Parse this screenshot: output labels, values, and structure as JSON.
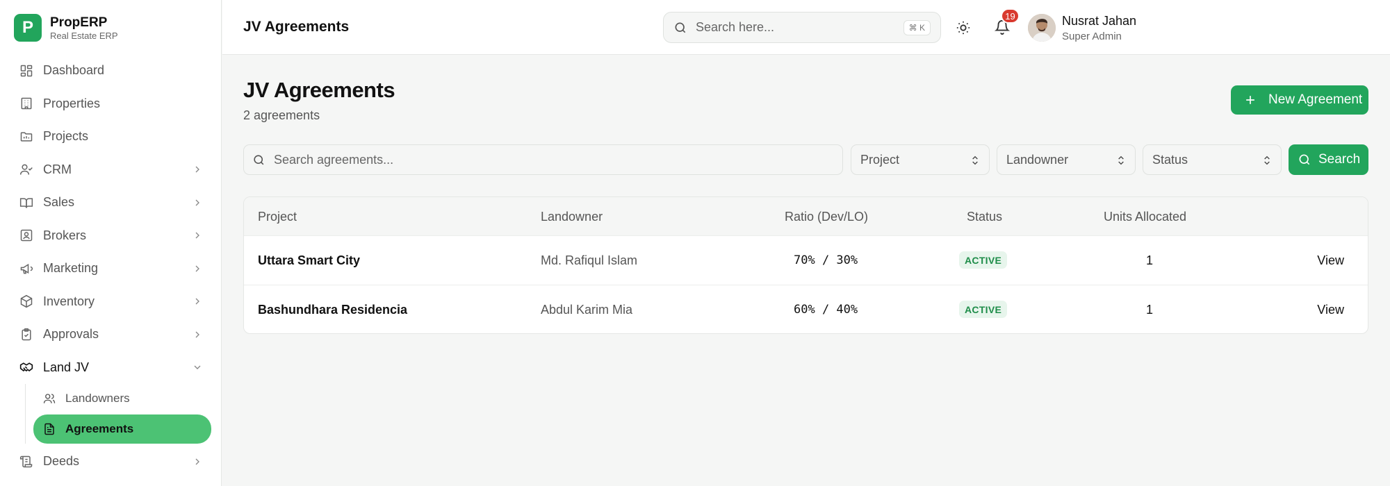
{
  "brand": {
    "name": "PropERP",
    "subtitle": "Real Estate ERP",
    "logo_letter": "P",
    "accent": "#22a55c"
  },
  "sidebar": {
    "items": [
      {
        "label": "Dashboard",
        "icon": "dashboard-icon"
      },
      {
        "label": "Properties",
        "icon": "building-icon"
      },
      {
        "label": "Projects",
        "icon": "folder-icon"
      },
      {
        "label": "CRM",
        "icon": "user-check-icon",
        "expandable": true
      },
      {
        "label": "Sales",
        "icon": "book-icon",
        "expandable": true
      },
      {
        "label": "Brokers",
        "icon": "id-badge-icon",
        "expandable": true
      },
      {
        "label": "Marketing",
        "icon": "megaphone-icon",
        "expandable": true
      },
      {
        "label": "Inventory",
        "icon": "box-icon",
        "expandable": true
      },
      {
        "label": "Approvals",
        "icon": "clipboard-check-icon",
        "expandable": true
      },
      {
        "label": "Land JV",
        "icon": "handshake-icon",
        "expandable": true,
        "open": true
      },
      {
        "label": "Deeds",
        "icon": "scroll-icon",
        "expandable": true
      }
    ],
    "land_jv_sub": [
      {
        "label": "Landowners",
        "icon": "users-icon"
      },
      {
        "label": "Agreements",
        "icon": "file-text-icon",
        "active": true
      }
    ],
    "active_color": "#4cc274"
  },
  "header": {
    "title": "JV Agreements",
    "search_placeholder": "Search here...",
    "shortcut": "⌘ K",
    "notification_count": "19",
    "user_name": "Nusrat Jahan",
    "user_role": "Super Admin"
  },
  "main": {
    "title": "JV Agreements",
    "count": "2 agreements",
    "new_button": "New Agreement",
    "filters": {
      "search_placeholder": "Search agreements...",
      "project": "Project",
      "landowner": "Landowner",
      "status": "Status",
      "search_button": "Search"
    },
    "table": {
      "columns": [
        "Project",
        "Landowner",
        "Ratio (Dev/LO)",
        "Status",
        "Units Allocated"
      ],
      "rows": [
        {
          "project": "Uttara Smart City",
          "landowner": "Md. Rafiqul Islam",
          "ratio": "70% / 30%",
          "status": "ACTIVE",
          "units": "1",
          "action": "View"
        },
        {
          "project": "Bashundhara Residencia",
          "landowner": "Abdul Karim Mia",
          "ratio": "60% / 40%",
          "status": "ACTIVE",
          "units": "1",
          "action": "View"
        }
      ]
    }
  }
}
